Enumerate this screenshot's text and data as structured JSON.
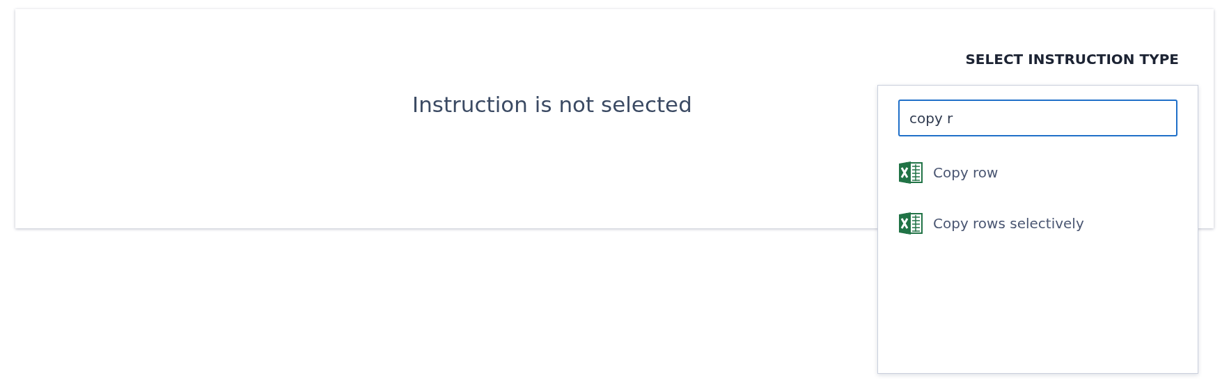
{
  "panel": {
    "heading": "SELECT INSTRUCTION TYPE",
    "empty_message": "Instruction is not selected"
  },
  "dropdown": {
    "search": {
      "value": "copy r"
    },
    "options": [
      {
        "label": "Copy row"
      },
      {
        "label": "Copy rows selectively"
      }
    ]
  }
}
